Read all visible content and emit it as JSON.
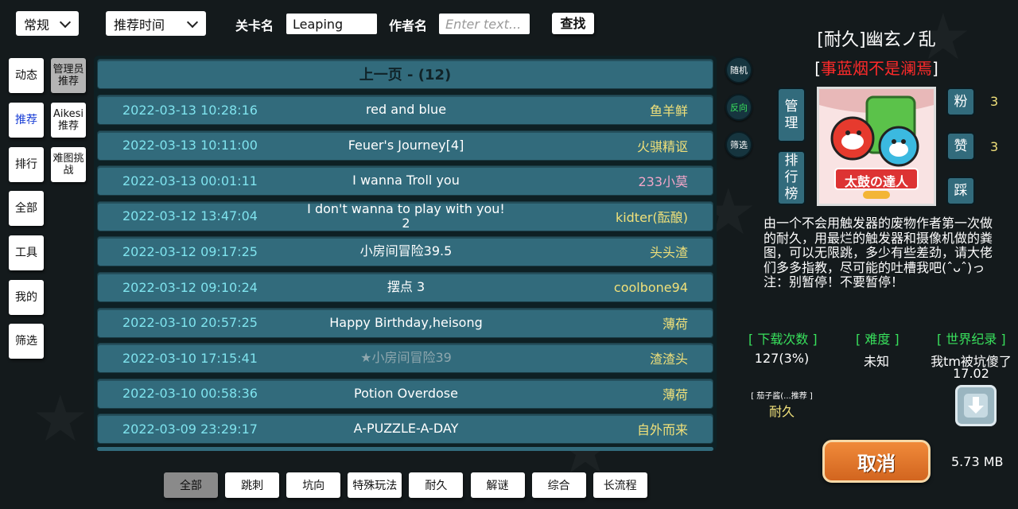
{
  "filters": {
    "category": "常规",
    "sort": "推荐时间",
    "level_name_label": "关卡名",
    "level_name_value": "Leaping",
    "author_label": "作者名",
    "author_placeholder": "Enter text...",
    "search_label": "查找"
  },
  "left_nav": [
    "动态",
    "推荐",
    "排行",
    "全部",
    "工具",
    "我的",
    "筛选"
  ],
  "left_nav_active": "推荐",
  "sub_nav": [
    "管理员推荐",
    "Aikesi推荐",
    "难图挑战"
  ],
  "list": {
    "header": "上一页 - (12)",
    "rows": [
      {
        "date": "2022-03-13 10:28:16",
        "title": "red and blue",
        "author": "鱼羊鲜",
        "author_color": "#f0e07a"
      },
      {
        "date": "2022-03-13 10:11:00",
        "title": "Feuer's Journey[4]",
        "author": "火骐精讴",
        "author_color": "#f0e07a"
      },
      {
        "date": "2022-03-13 00:01:11",
        "title": "I wanna Troll you",
        "author": "233小莫",
        "author_color": "#f2a6c8"
      },
      {
        "date": "2022-03-12 13:47:04",
        "title": "I don't wanna to play with you! 2",
        "author": "kidter(酝酿)",
        "author_color": "#f0e07a"
      },
      {
        "date": "2022-03-12 09:17:25",
        "title": "小房间冒险39.5",
        "author": "头头渣",
        "author_color": "#f0e07a"
      },
      {
        "date": "2022-03-12 09:10:24",
        "title": "摆点 3",
        "author": "coolbone94",
        "author_color": "#f0e07a"
      },
      {
        "date": "2022-03-10 20:57:25",
        "title": "Happy Birthday,heisong",
        "author": "薄荷",
        "author_color": "#f0e07a"
      },
      {
        "date": "2022-03-10 17:15:41",
        "title": "★小房间冒险39",
        "author": "渣渣头",
        "author_color": "#f0e07a",
        "dim": true
      },
      {
        "date": "2022-03-10 00:58:36",
        "title": "Potion Overdose",
        "author": "薄荷",
        "author_color": "#f0e07a"
      },
      {
        "date": "2022-03-09 23:29:17",
        "title": "A-PUZZLE-A-DAY",
        "author": "自外而来",
        "author_color": "#f0e07a"
      }
    ]
  },
  "round_buttons": [
    "随机",
    "反向",
    "筛选"
  ],
  "detail": {
    "title": "[耐久]幽玄ノ乱",
    "author_prefix": "[",
    "author": "事蓝烟不是澜焉",
    "author_suffix": "]",
    "manage": "管理",
    "leaderboard": "排行榜",
    "fans_label": "粉",
    "fans_count": "3",
    "like_label": "赞",
    "like_count": "3",
    "dislike_label": "踩",
    "description": "由一个不会用触发器的废物作者第一次做的耐久，用最烂的触发器和摄像机做的粪图，可以无限跳，多少有些差劲，请大佬们多多指教，尽可能的吐槽我吧(ˆᴗˆ)っ　　注：别暂停！不要暂停！",
    "downloads_label": "[ 下载次数 ]",
    "downloads_value": "127(3%)",
    "difficulty_label": "[ 难度 ]",
    "difficulty_value": "未知",
    "record_label": "[ 世界纪录 ]",
    "record_holder": "我tm被坑傻了",
    "record_time": "17.02",
    "recommend_label": "[ 茄子酱(...推荐 ]",
    "recommend_tag": "耐久",
    "cancel_label": "取消",
    "size": "5.73 MB",
    "cover_text": "太鼓の達人"
  },
  "tags": [
    "全部",
    "跳刺",
    "坑向",
    "特殊玩法",
    "耐久",
    "解谜",
    "综合",
    "长流程"
  ],
  "tags_active": "全部",
  "colors": {
    "accent_green": "#38e05c",
    "author_red": "#ff2a2a",
    "row_bg": "#326b7c",
    "date_cyan": "#7fe3ee",
    "author_yellow": "#f0e07a",
    "cancel_orange": "#e07a2e"
  }
}
